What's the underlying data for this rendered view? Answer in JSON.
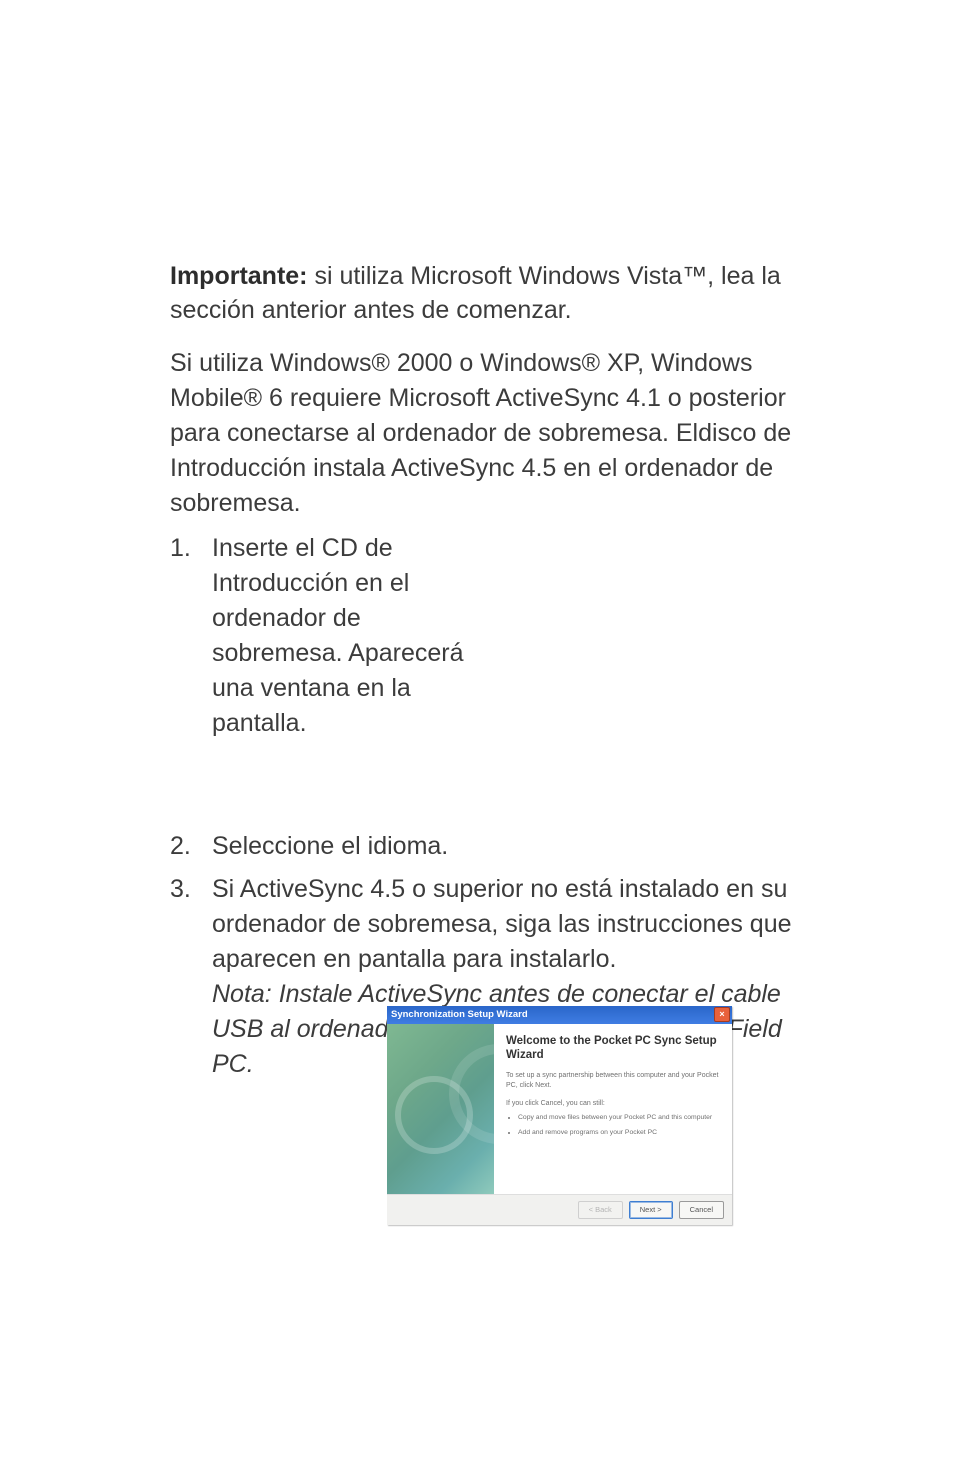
{
  "paragraphs": {
    "important_label": "Importante:",
    "important_text": " si utiliza Microsoft Windows Vista™, lea la sección anterior antes de comenzar.",
    "body1": "Si utiliza Windows® 2000 o Windows® XP, Windows Mobile® 6 requiere Microsoft ActiveSync 4.1 o posterior para conectarse al ordenador de sobremesa. Eldisco de Introducción instala ActiveSync 4.5 en el ordenador de sobremesa."
  },
  "list": {
    "item1": {
      "num": "1.",
      "text": "Inserte el CD de Introducción en el ordenador de sobremesa. Aparecerá una ventana en la pantalla."
    },
    "item2": {
      "num": "2.",
      "text": "Seleccione el idioma."
    },
    "item3": {
      "num": "3.",
      "text": "Si ActiveSync 4.5 o superior no está instalado en su ordenador de sobremesa, siga las instrucciones que aparecen en pantalla para instalarlo.",
      "note": "Nota: Instale ActiveSync antes de conectar el cable USB al ordenador de sobremesa o dispositivo Field PC."
    }
  },
  "wizard": {
    "title": "Synchronization Setup Wizard",
    "heading": "Welcome to the Pocket PC Sync Setup Wizard",
    "sub1": "To set up a sync partnership between this computer and your Pocket PC, click Next.",
    "sub2": "If you click Cancel, you can still:",
    "bullets": [
      "Copy and move files between your Pocket PC and this computer",
      "Add and remove programs on your Pocket PC"
    ],
    "buttons": {
      "back": "< Back",
      "next": "Next >",
      "cancel": "Cancel"
    }
  }
}
